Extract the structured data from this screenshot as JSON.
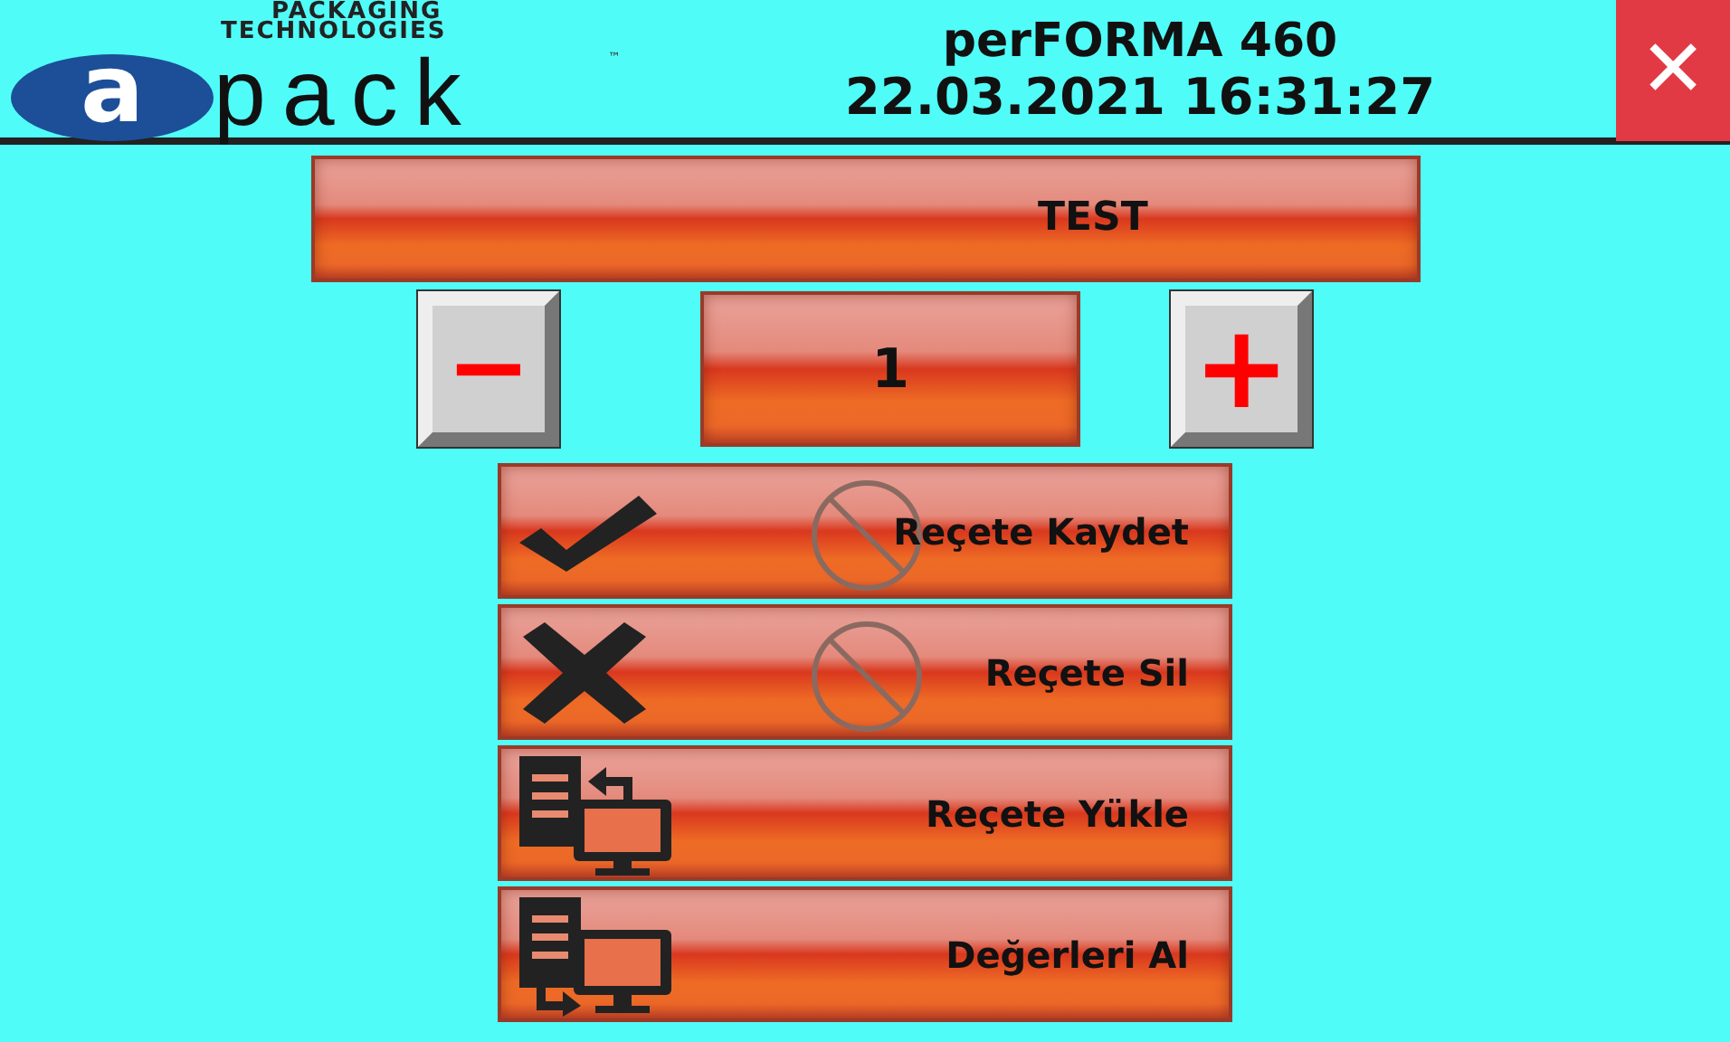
{
  "header": {
    "logo": {
      "line_1": "PACKAGING",
      "line_2": "TECHNOLOGIES",
      "letter": "a",
      "word": "pack",
      "mark": "™"
    },
    "title": "perFORMA 460",
    "datetime": "22.03.2021 16:31:27",
    "close": "✕"
  },
  "recipe_name": "TEST",
  "counter": {
    "minus": "−",
    "value": "1",
    "plus": "+"
  },
  "actions": [
    {
      "kind": "save",
      "label": "Reçete Kaydet",
      "disabled": true
    },
    {
      "kind": "delete",
      "label": "Reçete Sil",
      "disabled": true
    },
    {
      "kind": "load",
      "label": "Reçete Yükle",
      "disabled": false
    },
    {
      "kind": "fetch",
      "label": "Değerleri Al",
      "disabled": false
    }
  ]
}
